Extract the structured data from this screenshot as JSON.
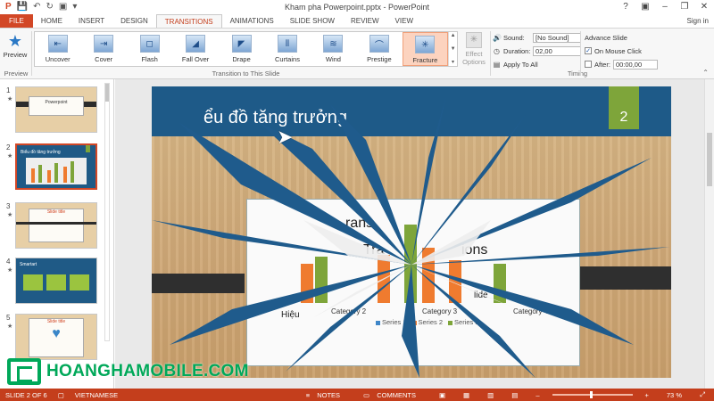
{
  "window": {
    "title": "Kham pha Powerpoint.pptx - PowerPoint"
  },
  "tabs": [
    {
      "label": "FILE"
    },
    {
      "label": "HOME"
    },
    {
      "label": "INSERT"
    },
    {
      "label": "DESIGN"
    },
    {
      "label": "TRANSITIONS"
    },
    {
      "label": "ANIMATIONS"
    },
    {
      "label": "SLIDE SHOW"
    },
    {
      "label": "REVIEW"
    },
    {
      "label": "VIEW"
    }
  ],
  "account": {
    "sign_in": "Sign in"
  },
  "ribbon": {
    "preview": {
      "label": "Preview",
      "group": "Preview"
    },
    "transitions": [
      {
        "label": "Uncover",
        "icon": "uncover-icon"
      },
      {
        "label": "Cover",
        "icon": "cover-icon"
      },
      {
        "label": "Flash",
        "icon": "flash-icon"
      },
      {
        "label": "Fall Over",
        "icon": "fall-over-icon"
      },
      {
        "label": "Drape",
        "icon": "drape-icon"
      },
      {
        "label": "Curtains",
        "icon": "curtains-icon"
      },
      {
        "label": "Wind",
        "icon": "wind-icon"
      },
      {
        "label": "Prestige",
        "icon": "prestige-icon"
      },
      {
        "label": "Fracture",
        "icon": "fracture-icon",
        "selected": true
      }
    ],
    "transitions_group": "Transition to This Slide",
    "effect_options": {
      "line1": "Effect",
      "line2": "Options"
    },
    "timing": {
      "sound_label": "Sound:",
      "sound_value": "[No Sound]",
      "duration_label": "Duration:",
      "duration_value": "02,00",
      "apply_all": "Apply To All",
      "group": "Timing"
    },
    "advance": {
      "title": "Advance Slide",
      "on_click": "On Mouse Click",
      "after": "After:",
      "after_value": "00:00,00"
    }
  },
  "slides": [
    {
      "num": "1",
      "star": "★",
      "thumb_text": "Powerpoint"
    },
    {
      "num": "2",
      "star": "★",
      "thumb_text": "Biểu đồ tăng trưởng",
      "active": true
    },
    {
      "num": "3",
      "star": "★",
      "thumb_text": "Slide title"
    },
    {
      "num": "4",
      "star": "★",
      "thumb_text": "Smartart"
    },
    {
      "num": "5",
      "star": "★",
      "thumb_text": "Slide title"
    }
  ],
  "slide": {
    "title": "ểu đồ tăng trưởng",
    "number": "2",
    "ghost_text_1": "rans",
    "ghost_text_2": "Tra",
    "ghost_text_3": "ions",
    "ghost_text_4": "Hiệu",
    "ghost_text_5": "lide",
    "categories": [
      "Category 2",
      "Category 3",
      "Category 4"
    ],
    "legend": [
      "Series 1",
      "Series 2",
      "Series 3"
    ],
    "colors": {
      "series1": "#3e86c8",
      "series2": "#ef7b2f",
      "series3": "#7ea53a"
    }
  },
  "watermark": {
    "text": "HOANGHAMOBILE.COM"
  },
  "status": {
    "slide_of": "SLIDE 2 OF 6",
    "language": "VIETNAMESE",
    "notes": "NOTES",
    "comments": "COMMENTS",
    "zoom": "73 %"
  }
}
